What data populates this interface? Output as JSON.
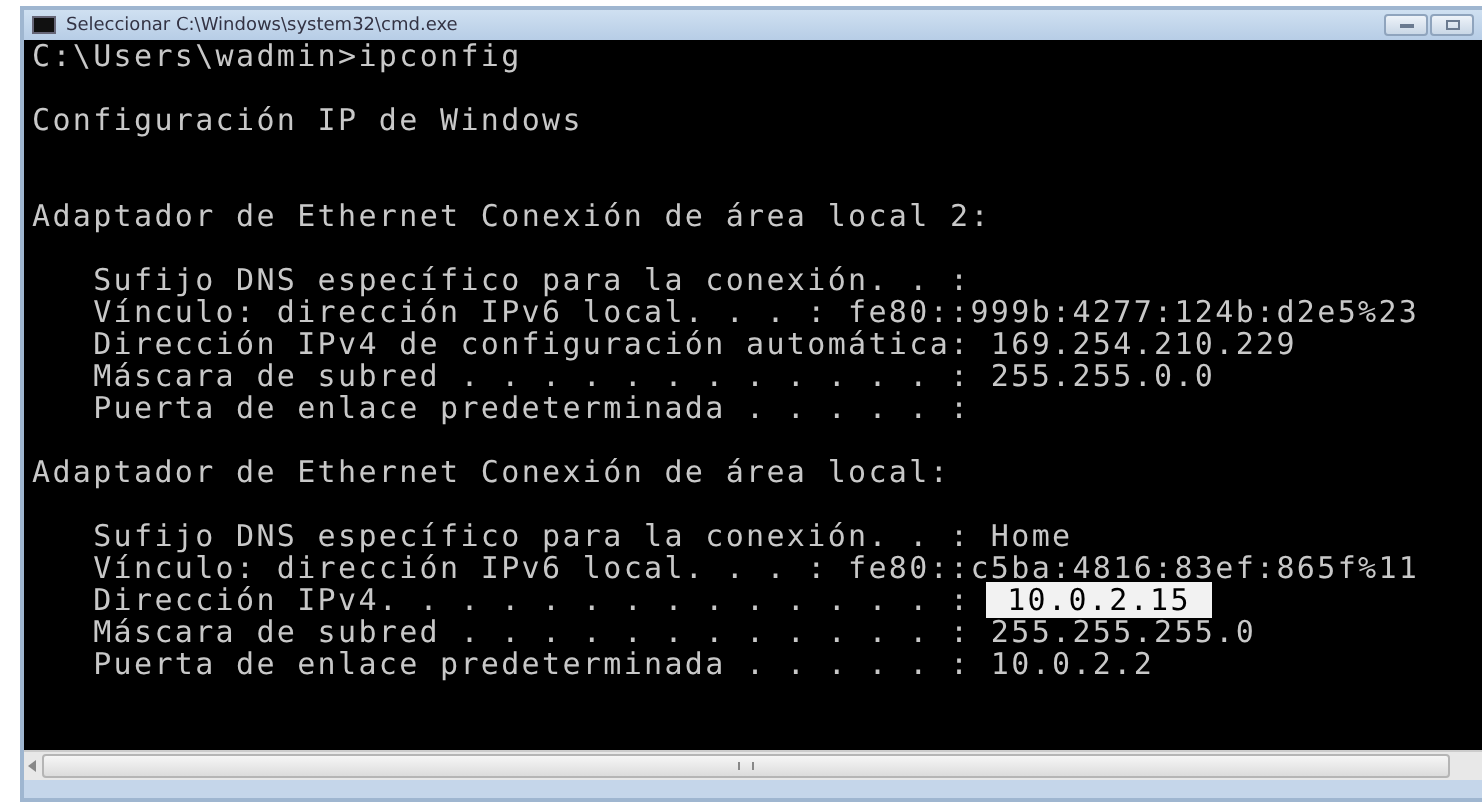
{
  "window": {
    "title": "Seleccionar C:\\Windows\\system32\\cmd.exe"
  },
  "console": [
    {
      "kind": "prompt",
      "text": "C:\\Users\\wadmin>ipconfig"
    },
    {
      "kind": "title",
      "text": "Configuración IP de Windows"
    },
    {
      "kind": "section",
      "text": "Adaptador de Ethernet Conexión de área local 2:"
    },
    {
      "kind": "details",
      "entries": [
        {
          "label": "Sufijo DNS específico para la conexión. . :",
          "selected": false
        },
        {
          "label": "Vínculo: dirección IPv6 local. . . :",
          "value": "fe80::999b:4277:124b:d2e5%23",
          "selected": false
        },
        {
          "label": "Dirección IPv4 de configuración automática:",
          "value": "169.254.210.229",
          "selected": false
        },
        {
          "label": "Máscara de subred . . . . . . . . . . . . :",
          "value": "255.255.0.0",
          "selected": false
        },
        {
          "label": "Puerta de enlace predeterminada . . . . . :",
          "selected": false
        }
      ]
    },
    {
      "kind": "section",
      "text": "Adaptador de Ethernet Conexión de área local:"
    },
    {
      "kind": "details",
      "entries": [
        {
          "label": "Sufijo DNS específico para la conexión. . :",
          "value": "Home",
          "selected": false
        },
        {
          "label": "Vínculo: dirección IPv6 local. . . :",
          "value": "fe80::c5ba:4816:83ef:865f%11",
          "selected": false
        },
        {
          "label": "Dirección IPv4. . . . . . . . . . . . . . :",
          "value": "10.0.2.15",
          "selected": true
        },
        {
          "label": "Máscara de subred . . . . . . . . . . . . :",
          "value": "255.255.255.0",
          "selected": false
        },
        {
          "label": "Puerta de enlace predeterminada . . . . . :",
          "value": "10.0.2.2",
          "selected": false
        }
      ]
    }
  ]
}
